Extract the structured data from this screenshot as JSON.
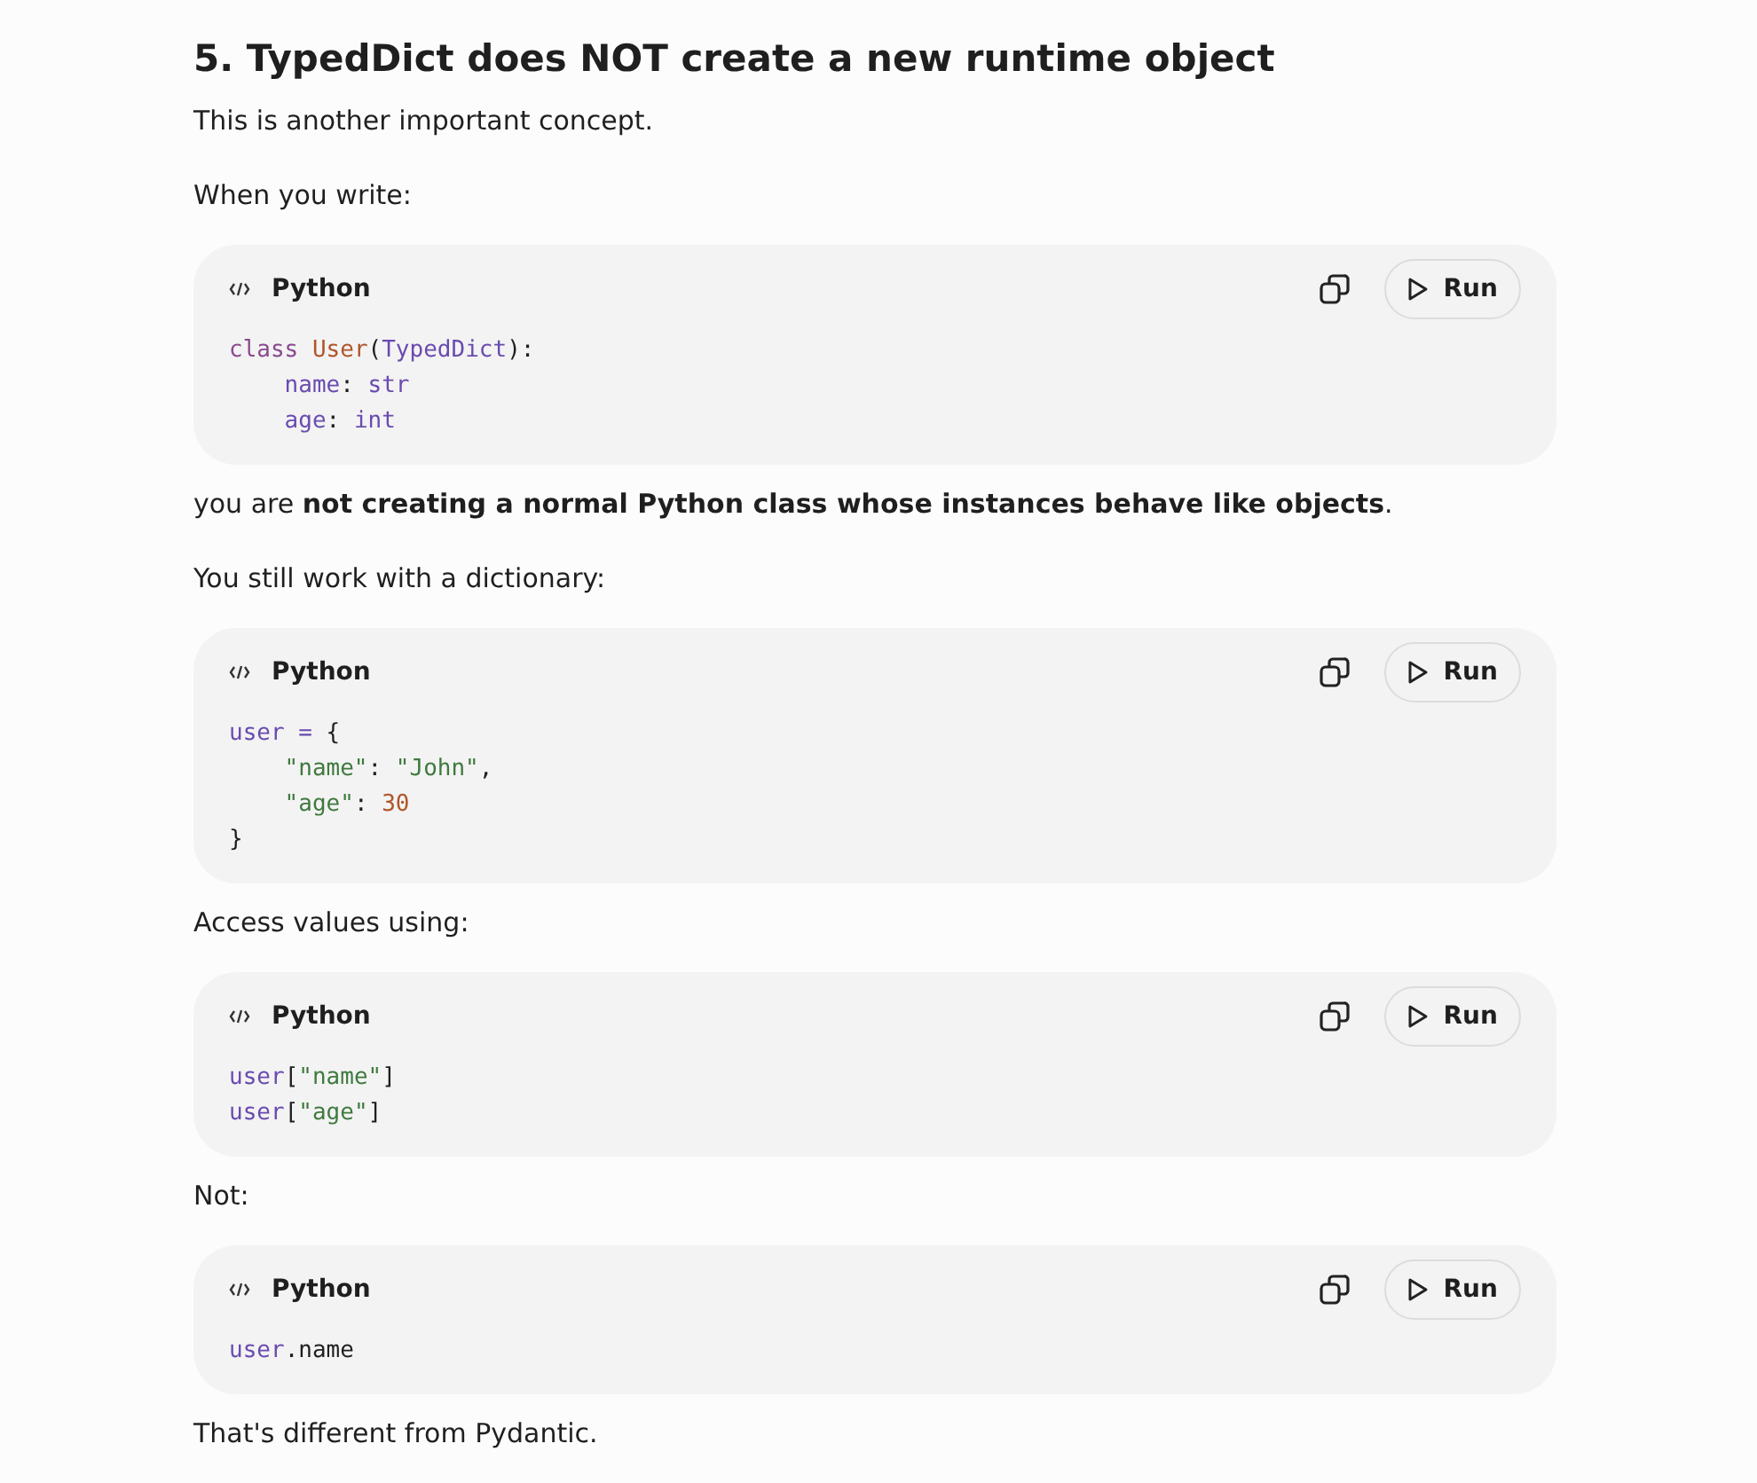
{
  "heading": "5. TypedDict does NOT create a new runtime object",
  "blocks": [
    {
      "kind": "paragraph",
      "text": "This is another important concept."
    },
    {
      "kind": "paragraph",
      "text": "When you write:"
    },
    {
      "kind": "code",
      "language": "Python",
      "run_label": "Run",
      "lines": [
        {
          "indent": false,
          "tokens": [
            {
              "kind": "keyword",
              "text": "class"
            },
            {
              "kind": "classname",
              "text": " User"
            },
            {
              "kind": "plain",
              "text": "("
            },
            {
              "kind": "name",
              "text": "TypedDict"
            },
            {
              "kind": "plain",
              "text": "):"
            }
          ]
        },
        {
          "indent": true,
          "tokens": [
            {
              "kind": "name",
              "text": "name"
            },
            {
              "kind": "plain",
              "text": ": "
            },
            {
              "kind": "name",
              "text": "str"
            }
          ]
        },
        {
          "indent": true,
          "tokens": [
            {
              "kind": "name",
              "text": "age"
            },
            {
              "kind": "plain",
              "text": ": "
            },
            {
              "kind": "name",
              "text": "int"
            }
          ]
        }
      ]
    },
    {
      "kind": "paragraph",
      "text": "you are **not creating a normal Python class whose instances behave like objects**."
    },
    {
      "kind": "paragraph",
      "text": "You still work with a dictionary:"
    },
    {
      "kind": "code",
      "language": "Python",
      "run_label": "Run",
      "lines": [
        {
          "indent": false,
          "tokens": [
            {
              "kind": "name",
              "text": "user"
            },
            {
              "kind": "operator",
              "text": " ="
            },
            {
              "kind": "plain",
              "text": " {"
            }
          ]
        },
        {
          "indent": true,
          "tokens": [
            {
              "kind": "string",
              "text": "\"name\""
            },
            {
              "kind": "plain",
              "text": ": "
            },
            {
              "kind": "string",
              "text": "\"John\""
            },
            {
              "kind": "plain",
              "text": ","
            }
          ]
        },
        {
          "indent": true,
          "tokens": [
            {
              "kind": "string",
              "text": "\"age\""
            },
            {
              "kind": "plain",
              "text": ": "
            },
            {
              "kind": "number",
              "text": "30"
            }
          ]
        },
        {
          "indent": false,
          "tokens": [
            {
              "kind": "plain",
              "text": "}"
            }
          ]
        }
      ]
    },
    {
      "kind": "paragraph",
      "text": "Access values using:"
    },
    {
      "kind": "code",
      "language": "Python",
      "run_label": "Run",
      "lines": [
        {
          "indent": false,
          "tokens": [
            {
              "kind": "name",
              "text": "user"
            },
            {
              "kind": "plain",
              "text": "["
            },
            {
              "kind": "string",
              "text": "\"name\""
            },
            {
              "kind": "plain",
              "text": "]"
            }
          ]
        },
        {
          "indent": false,
          "tokens": [
            {
              "kind": "name",
              "text": "user"
            },
            {
              "kind": "plain",
              "text": "["
            },
            {
              "kind": "string",
              "text": "\"age\""
            },
            {
              "kind": "plain",
              "text": "]"
            }
          ]
        }
      ]
    },
    {
      "kind": "paragraph",
      "text": "Not:"
    },
    {
      "kind": "code",
      "language": "Python",
      "run_label": "Run",
      "lines": [
        {
          "indent": false,
          "tokens": [
            {
              "kind": "name",
              "text": "user"
            },
            {
              "kind": "plain",
              "text": ".name"
            }
          ]
        }
      ]
    },
    {
      "kind": "paragraph",
      "text": "That's different from Pydantic."
    }
  ]
}
